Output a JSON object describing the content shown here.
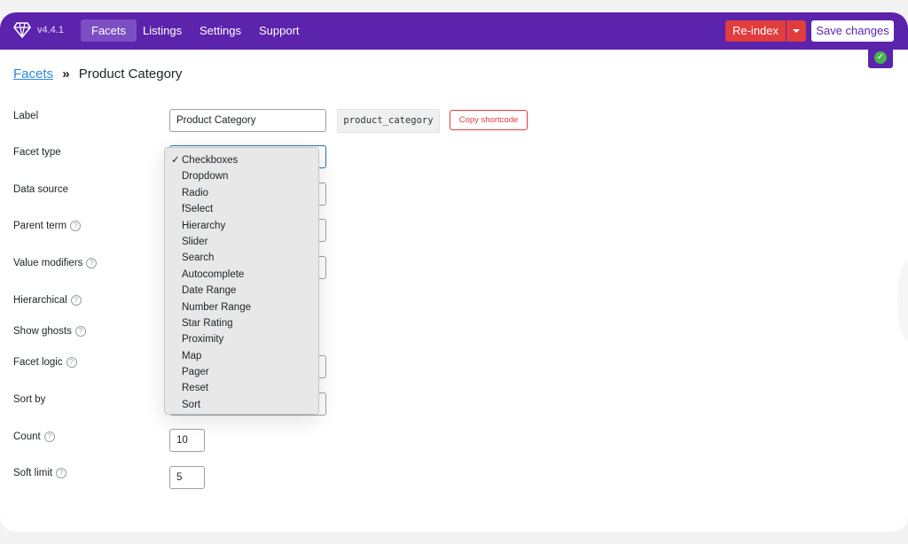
{
  "app": {
    "version": "v4.4.1"
  },
  "nav": [
    {
      "label": "Facets",
      "active": true
    },
    {
      "label": "Listings",
      "active": false
    },
    {
      "label": "Settings",
      "active": false
    },
    {
      "label": "Support",
      "active": false
    }
  ],
  "toolbar": {
    "reindex_label": "Re-index",
    "save_label": "Save changes"
  },
  "breadcrumb": {
    "parent": "Facets",
    "separator": "»",
    "current": "Product Category"
  },
  "form": {
    "label": {
      "label": "Label",
      "value": "Product Category"
    },
    "facet_name": "product_category",
    "copy_shortcode_label": "Copy shortcode",
    "facet_type": {
      "label": "Facet type"
    },
    "data_source": {
      "label": "Data source"
    },
    "parent_term": {
      "label": "Parent term"
    },
    "value_modifiers": {
      "label": "Value modifiers"
    },
    "hierarchical": {
      "label": "Hierarchical"
    },
    "show_ghosts": {
      "label": "Show ghosts"
    },
    "facet_logic": {
      "label": "Facet logic"
    },
    "sort_by": {
      "label": "Sort by"
    },
    "count": {
      "label": "Count",
      "value": "10"
    },
    "soft_limit": {
      "label": "Soft limit",
      "value": "5"
    }
  },
  "help_glyph": "?",
  "dropdown": {
    "selected_index": 0,
    "check_glyph": "✓",
    "options": [
      "Checkboxes",
      "Dropdown",
      "Radio",
      "fSelect",
      "Hierarchy",
      "Slider",
      "Search",
      "Autocomplete",
      "Date Range",
      "Number Range",
      "Star Rating",
      "Proximity",
      "Map",
      "Pager",
      "Reset",
      "Sort"
    ]
  },
  "colors": {
    "brand": "#5c23ad",
    "active_tab": "#7c4ec3",
    "danger": "#e23d3d",
    "link": "#2a8bdc",
    "success": "#46b450"
  }
}
